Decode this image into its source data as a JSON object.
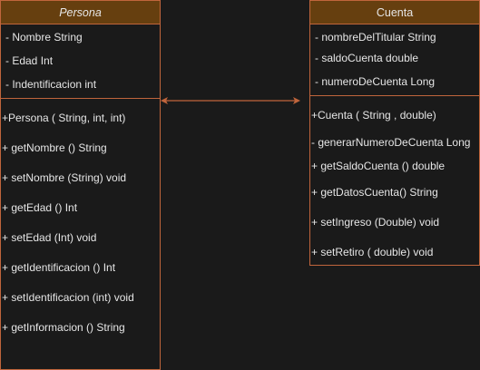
{
  "persona": {
    "name": "Persona",
    "attributes": [
      " - Nombre String",
      " - Edad Int",
      " - Indentificacion int"
    ],
    "methods": [
      "+Persona ( String, int, int)",
      "+ getNombre () String",
      "+ setNombre (String) void",
      "+ getEdad () Int",
      "+ setEdad (Int) void",
      "+ getIdentificacion () Int",
      "+ setIdentificacion (int) void",
      "+ getInformacion () String"
    ]
  },
  "cuenta": {
    "name": "Cuenta",
    "attributes": [
      " - nombreDelTitular String",
      " - saldoCuenta double",
      " - numeroDeCuenta Long"
    ],
    "methods": [
      "+Cuenta ( String , double)",
      " - generarNumeroDeCuenta Long",
      " + getSaldoCuenta () double",
      "+ getDatosCuenta() String",
      "+ setIngreso (Double) void",
      "+ setRetiro  ( double) void"
    ]
  },
  "colors": {
    "background": "#1a1a1a",
    "header_fill": "#663f0f",
    "border": "#c0653c",
    "text": "#e6e6e6"
  }
}
